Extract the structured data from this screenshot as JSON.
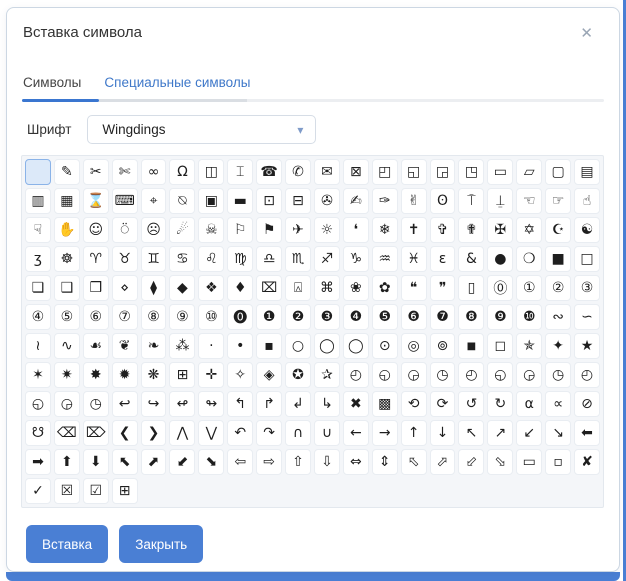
{
  "dialog": {
    "title": "Вставка символа",
    "close_icon": "✕",
    "tabs": [
      {
        "label": "Символы",
        "active": true
      },
      {
        "label": "Специальные символы",
        "active": false
      }
    ],
    "font_label": "Шрифт",
    "font_value": "Wingdings",
    "chevron_icon": "▾",
    "buttons": {
      "insert": "Вставка",
      "close": "Закрыть"
    },
    "accent_color": "#4a7fd4",
    "link_color": "#3f78c9",
    "tab_underline_color": "#3a76d0"
  },
  "symbols": {
    "selected_index": 0,
    "columns": 20,
    "cells": [
      "",
      "✎",
      "✂",
      "✄",
      "∞",
      "Ω",
      "◫",
      "⌶",
      "☎",
      "✆",
      "✉",
      "⊠",
      "◰",
      "◱",
      "◲",
      "◳",
      "▭",
      "▱",
      "▢",
      "▤",
      "▥",
      "▦",
      "⌛",
      "⌨",
      "⌖",
      "⍉",
      "▣",
      "▬",
      "⊡",
      "⊟",
      "✇",
      "✍",
      "✑",
      "✌",
      "ʘ",
      "⍑",
      "⍊",
      "☜",
      "☞",
      "☝",
      "☟",
      "✋",
      "☺",
      "⍥",
      "☹",
      "☄",
      "☠",
      "⚐",
      "⚑",
      "✈",
      "☼",
      "❛",
      "❄",
      "✝",
      "✞",
      "✟",
      "✠",
      "✡",
      "☪",
      "☯",
      "ʒ",
      "☸",
      "♈",
      "♉",
      "♊",
      "♋",
      "♌",
      "♍",
      "♎",
      "♏",
      "♐",
      "♑",
      "♒",
      "♓",
      "ɛ",
      "&",
      "●",
      "❍",
      "■",
      "□",
      "❏",
      "❑",
      "❒",
      "⋄",
      "⧫",
      "◆",
      "❖",
      "♦",
      "⌧",
      "⍓",
      "⌘",
      "❀",
      "✿",
      "❝",
      "❞",
      "▯",
      "⓪",
      "①",
      "②",
      "③",
      "④",
      "⑤",
      "⑥",
      "⑦",
      "⑧",
      "⑨",
      "⑩",
      "⓿",
      "❶",
      "❷",
      "❸",
      "❹",
      "❺",
      "❻",
      "❼",
      "❽",
      "❾",
      "❿",
      "∾",
      "∽",
      "≀",
      "∿",
      "☙",
      "❦",
      "❧",
      "⁂",
      "·",
      "•",
      "▪",
      "○",
      "◯",
      "◯",
      "⊙",
      "◎",
      "⊚",
      "◾",
      "◻",
      "✯",
      "✦",
      "★",
      "✶",
      "✷",
      "✸",
      "✹",
      "❋",
      "⊞",
      "✛",
      "✧",
      "◈",
      "✪",
      "✰",
      "◴",
      "◵",
      "◶",
      "◷",
      "◴",
      "◵",
      "◶",
      "◷",
      "◴",
      "◵",
      "◶",
      "◷",
      "↩",
      "↪",
      "↫",
      "↬",
      "↰",
      "↱",
      "↲",
      "↳",
      "✖",
      "▩",
      "⟲",
      "⟳",
      "↺",
      "↻",
      "⍺",
      "∝",
      "⊘",
      "☋",
      "⌫",
      "⌦",
      "❮",
      "❯",
      "⋀",
      "⋁",
      "↶",
      "↷",
      "∩",
      "∪",
      "←",
      "→",
      "↑",
      "↓",
      "↖",
      "↗",
      "↙",
      "↘",
      "⬅",
      "➡",
      "⬆",
      "⬇",
      "⬉",
      "⬈",
      "⬋",
      "⬊",
      "⇦",
      "⇨",
      "⇧",
      "⇩",
      "⇔",
      "⇕",
      "⬁",
      "⬀",
      "⬃",
      "⬂",
      "▭",
      "▫",
      "✘",
      "✓",
      "☒",
      "☑",
      "⊞"
    ]
  }
}
